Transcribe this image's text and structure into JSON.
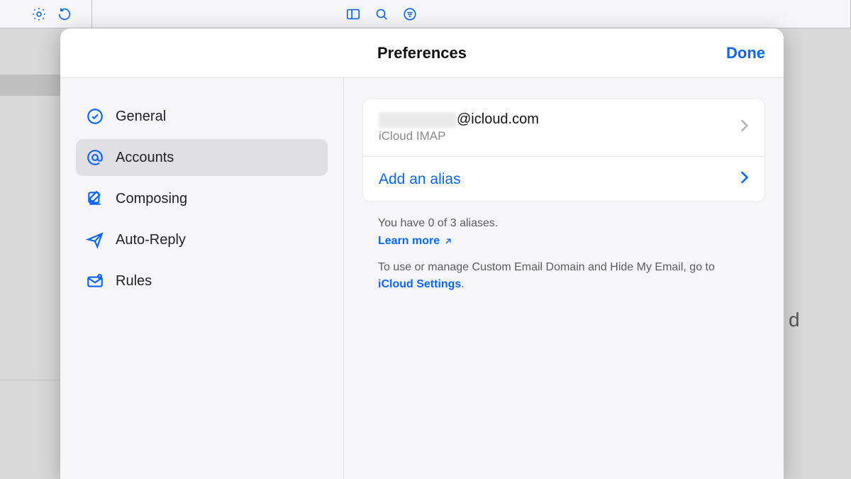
{
  "modal": {
    "title": "Preferences",
    "done": "Done"
  },
  "sidebar": {
    "items": [
      {
        "label": "General"
      },
      {
        "label": "Accounts"
      },
      {
        "label": "Composing"
      },
      {
        "label": "Auto-Reply"
      },
      {
        "label": "Rules"
      }
    ]
  },
  "account": {
    "email_suffix": "@icloud.com",
    "subtitle": "iCloud IMAP",
    "add_alias": "Add an alias"
  },
  "footer": {
    "alias_count": "You have 0 of 3 aliases.",
    "learn_more": "Learn more",
    "custom_domain_pre": "To use or manage Custom Email Domain and Hide My Email, go to ",
    "icloud_settings": "iCloud Settings",
    "period": "."
  }
}
